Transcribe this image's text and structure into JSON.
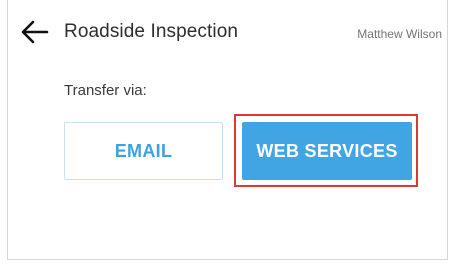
{
  "header": {
    "back_icon": "arrow-left-icon",
    "title": "Roadside Inspection",
    "user_name": "Matthew Wilson"
  },
  "transfer": {
    "label": "Transfer via:",
    "email_label": "EMAIL",
    "web_services_label": "WEB SERVICES"
  },
  "colors": {
    "accent": "#42a5e3",
    "highlight_border": "#d93a31"
  }
}
